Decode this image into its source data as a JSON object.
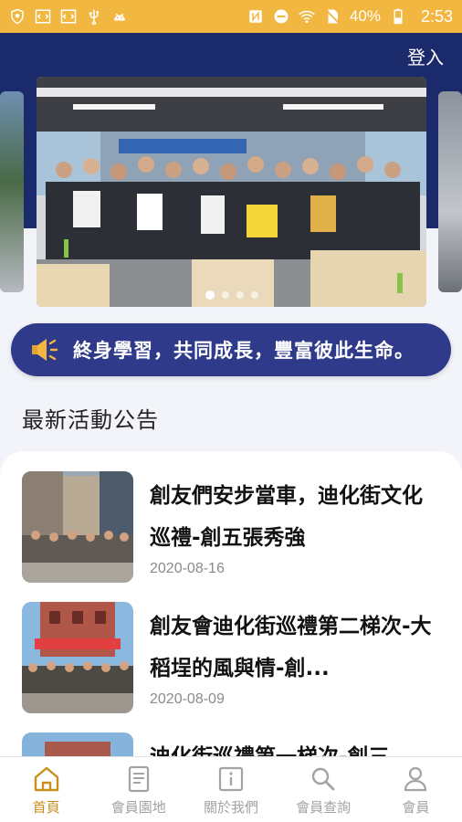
{
  "status_bar": {
    "battery_percent": "40%",
    "clock": "2:53",
    "left_icons": [
      "shield-icon",
      "code-icon",
      "code-icon",
      "usb-icon",
      "android-icon"
    ],
    "right_icons": [
      "nfc-icon",
      "do-not-disturb-icon",
      "wifi-icon",
      "no-sim-icon",
      "battery-icon"
    ]
  },
  "header": {
    "login_label": "登入",
    "carousel": {
      "page_count": 4,
      "active_index": 0
    }
  },
  "slogan": {
    "icon": "megaphone-icon",
    "text": "終身學習，共同成長，豐富彼此生命。"
  },
  "section": {
    "title": "最新活動公告"
  },
  "news": [
    {
      "title": "創友們安步當車，迪化街文化巡禮-創五張秀強",
      "date": "2020-08-16"
    },
    {
      "title": "創友會迪化街巡禮第二梯次-大稻埕的風與情-創...",
      "date": "2020-08-09"
    },
    {
      "title": "迪化街巡禮第一梯次-創三",
      "date": ""
    }
  ],
  "bottom_nav": [
    {
      "label": "首頁",
      "icon": "home-icon",
      "active": true
    },
    {
      "label": "會員園地",
      "icon": "document-icon",
      "active": false
    },
    {
      "label": "關於我們",
      "icon": "info-icon",
      "active": false
    },
    {
      "label": "會員查詢",
      "icon": "search-icon",
      "active": false
    },
    {
      "label": "會員",
      "icon": "person-icon",
      "active": false
    }
  ],
  "colors": {
    "status_bar": "#f2b740",
    "header": "#1b2a6b",
    "slogan_bg": "#2f3a8a",
    "nav_active": "#c98f1b",
    "nav_inactive": "#a3a3a3"
  }
}
